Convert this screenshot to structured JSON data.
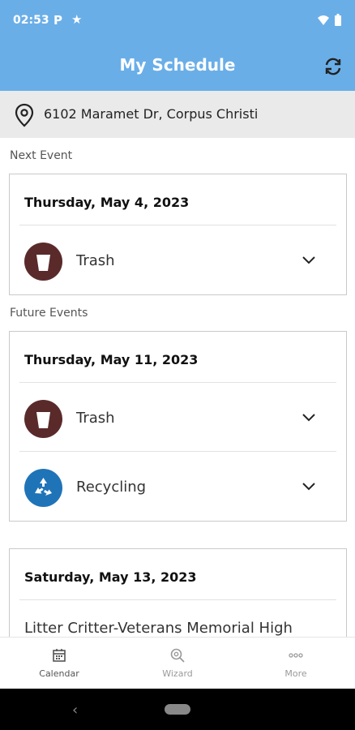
{
  "status_bar": {
    "time": "02:53",
    "p_glyph": "P",
    "star_glyph": "★"
  },
  "app_bar": {
    "title": "My Schedule",
    "refresh_icon": "refresh-icon"
  },
  "address": {
    "text": "6102 Maramet Dr, Corpus Christi",
    "icon": "location-pin-icon"
  },
  "next_event": {
    "label": "Next Event",
    "date": "Thursday, May 4, 2023",
    "items": [
      {
        "label": "Trash",
        "icon": "trash-bin-icon"
      }
    ]
  },
  "future_events": {
    "label": "Future Events",
    "cards": [
      {
        "date": "Thursday, May 11, 2023",
        "items": [
          {
            "label": "Trash",
            "icon": "trash-bin-icon"
          },
          {
            "label": "Recycling",
            "icon": "recycle-icon"
          }
        ]
      },
      {
        "date": "Saturday, May 13, 2023",
        "event_text": "Litter Critter-Veterans Memorial High"
      }
    ]
  },
  "bottom_nav": {
    "items": [
      {
        "label": "Calendar",
        "icon": "calendar-icon",
        "active": true
      },
      {
        "label": "Wizard",
        "icon": "wizard-icon",
        "active": false
      },
      {
        "label": "More",
        "icon": "more-icon",
        "active": false
      }
    ]
  },
  "colors": {
    "app_bar": "#6aaee8",
    "trash_bin": "#5a2a2a",
    "recycle_bin": "#1f74b8",
    "address_bg": "#eaeaea"
  }
}
